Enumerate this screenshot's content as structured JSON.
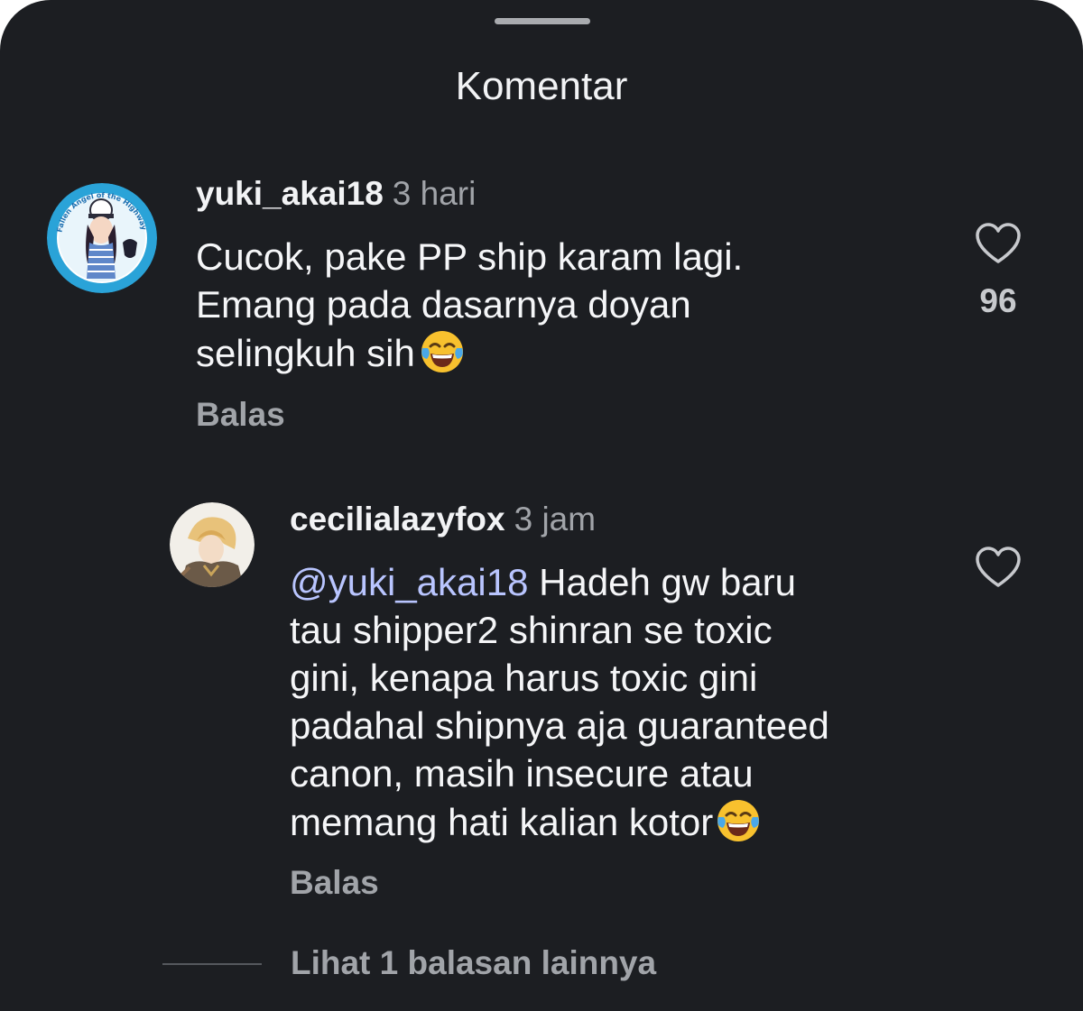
{
  "sheet": {
    "title": "Komentar"
  },
  "comments": [
    {
      "username": "yuki_akai18",
      "time": "3 hari",
      "lines": [
        "Cucok, pake PP ship karam lagi.",
        "Emang pada dasarnya doyan",
        "selingkuh sih"
      ],
      "emoji": "face-with-tears-of-joy",
      "avatar_text": "Fallen Angel of the Highway",
      "reply_label": "Balas",
      "likes": "96"
    },
    {
      "username": "cecilialazyfox",
      "time": "3 jam",
      "mention": "@yuki_akai18",
      "lines": [
        "Hadeh gw baru",
        "tau shipper2 shinran se toxic",
        "gini, kenapa harus toxic gini",
        "padahal shipnya aja guaranteed",
        "canon, masih insecure atau",
        "memang hati kalian kotor"
      ],
      "emoji": "face-with-tears-of-joy",
      "reply_label": "Balas"
    }
  ],
  "view_more_label": "Lihat 1 balasan lainnya",
  "colors": {
    "background": "#1c1e22",
    "text": "#f5f6f8",
    "muted": "#a1a4a9",
    "mention": "#b9c5ff"
  }
}
